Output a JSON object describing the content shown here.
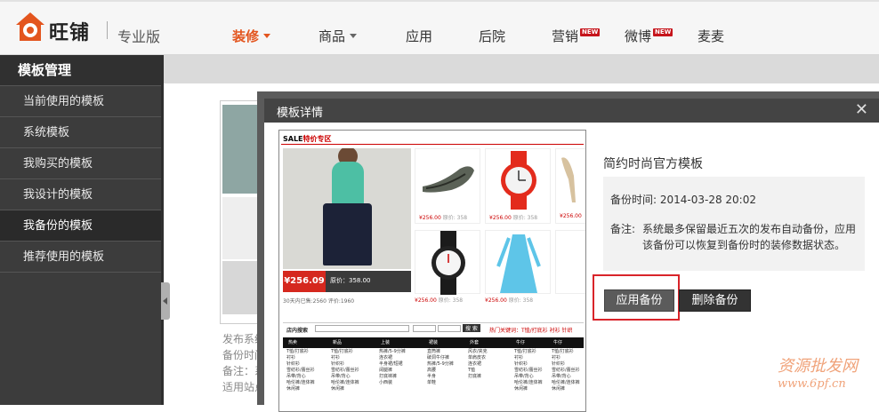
{
  "brand": {
    "logo_text": "旺铺",
    "edition": "专业版",
    "logo_color": "#e3551e"
  },
  "nav": [
    {
      "label": "装修",
      "active": true,
      "dropdown": true
    },
    {
      "label": "商品",
      "dropdown": true
    },
    {
      "label": "应用"
    },
    {
      "label": "后院"
    },
    {
      "label": "营销",
      "badge": "NEW"
    },
    {
      "label": "微博",
      "badge": "NEW"
    },
    {
      "label": "麦麦"
    }
  ],
  "sidebar": {
    "title": "模板管理",
    "items": [
      {
        "label": "当前使用的模板"
      },
      {
        "label": "系统模板"
      },
      {
        "label": "我购买的模板"
      },
      {
        "label": "我设计的模板"
      },
      {
        "label": "我备份的模板",
        "active": true
      },
      {
        "label": "推荐使用的模板"
      }
    ]
  },
  "background_card": {
    "lines": [
      "发布系统",
      "备份时间",
      "备注：系",
      "适用站点"
    ]
  },
  "modal": {
    "title": "模板详情",
    "close_icon": "close-icon",
    "preview": {
      "header_sale": "SALE",
      "header_sub": "特价专区",
      "main_price": "¥256.09",
      "main_orig": "原价：358.00",
      "main_sold": "30天内已售:2560   评价:1960",
      "product_price": "¥256.00",
      "product_orig": "原价: 358",
      "search_label": "店内搜索",
      "search_button": "搜 索",
      "hot_label": "热门关键词：T恤/打底衫  衬衫  针织",
      "categories": [
        "热卖",
        "新品",
        "上装",
        "裙装",
        "外套",
        "牛仔",
        "牛仔"
      ],
      "category_items": [
        [
          "T恤/打底衫",
          "衬衫",
          "针织衫",
          "雪纺衫/蕾丝衫",
          "吊带/背心",
          "哈伦裤/连体裤",
          "休闲裤"
        ],
        [
          "T恤/打底衫",
          "衬衫",
          "针织衫",
          "雪纺衫/蕾丝衫",
          "吊带/背心",
          "哈伦裤/连体裤",
          "休闲裤"
        ],
        [
          "热裤/5-9分裤",
          "连衣裙",
          "半身裙/短裙",
          "阔腿裤",
          "打底袜裤",
          "小西装"
        ],
        [
          "直筒裤",
          "破洞牛仔裤",
          "热裤/5-9分裤",
          "高腰",
          "半身",
          "单鞋"
        ],
        [
          "风衣/夹克",
          "单肩皮衣",
          "连衣裙",
          "T恤",
          "打底裤"
        ],
        [
          "T恤/打底衫",
          "衬衫",
          "针织衫",
          "雪纺衫/蕾丝衫",
          "吊带/背心",
          "哈伦裤/连体裤",
          "休闲裤"
        ],
        [
          "T恤/打底衫",
          "衬衫",
          "针织衫",
          "雪纺衫/蕾丝衫",
          "吊带/背心",
          "哈伦裤/连体裤",
          "休闲裤"
        ]
      ]
    },
    "template_name": "简约时尚官方模板",
    "backup_time_label": "备份时间: 2014-03-28 20:02",
    "note_label": "备注:",
    "note_text": "系统最多保留最近五次的发布自动备份，应用该备份可以恢复到备份时的装修数据状态。",
    "apply_button": "应用备份",
    "delete_button": "删除备份",
    "highlight_color": "#d9242a"
  },
  "watermark": {
    "line1": "资源批发网",
    "line2": "www.6pf.cn"
  }
}
